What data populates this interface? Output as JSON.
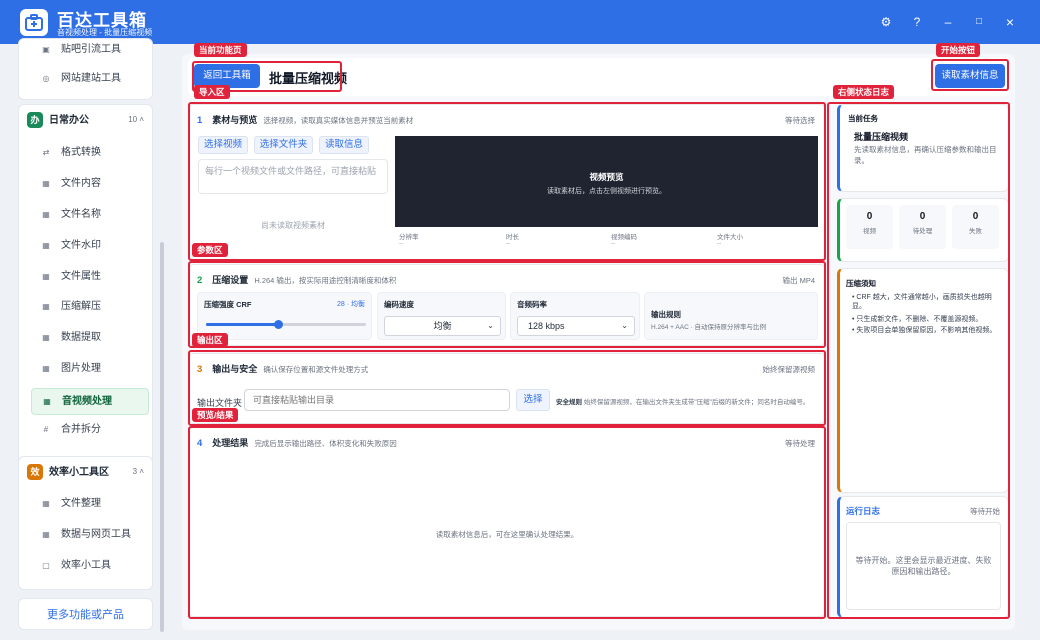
{
  "app": {
    "title": "百达工具箱",
    "subtitle": "音视频处理 - 批量压缩视频"
  },
  "window_controls": {
    "settings": "⚙",
    "help": "?",
    "minimize": "–",
    "maximize": "□",
    "close": "×"
  },
  "sidebar": {
    "top_items": [
      {
        "icon": "grid-icon",
        "label": "贴吧引流工具"
      },
      {
        "icon": "globe-icon",
        "label": "网站建站工具"
      }
    ],
    "group_office": {
      "badge": "办",
      "label": "日常办公",
      "count": "10 ˄",
      "color": "#1b8a5a"
    },
    "office_items": [
      {
        "icon": "swap-icon",
        "label": "格式转换"
      },
      {
        "icon": "grid-icon",
        "label": "文件内容"
      },
      {
        "icon": "grid-icon",
        "label": "文件名称"
      },
      {
        "icon": "grid-icon",
        "label": "文件水印"
      },
      {
        "icon": "grid-icon",
        "label": "文件属性"
      },
      {
        "icon": "grid-icon",
        "label": "压缩解压"
      },
      {
        "icon": "grid-icon",
        "label": "数据提取"
      },
      {
        "icon": "grid-icon",
        "label": "图片处理"
      },
      {
        "icon": "grid-icon",
        "label": "音视频处理"
      },
      {
        "icon": "hash-icon",
        "label": "合并拆分"
      }
    ],
    "group_efficiency": {
      "badge": "效",
      "label": "效率小工具区",
      "count": "3 ˄",
      "color": "#d97706"
    },
    "efficiency_items": [
      {
        "icon": "grid-icon",
        "label": "文件整理"
      },
      {
        "icon": "grid-icon",
        "label": "数据与网页工具"
      },
      {
        "icon": "box-icon",
        "label": "效率小工具"
      }
    ],
    "more_button": "更多功能或产品"
  },
  "annotations": {
    "current_page": "当前功能页",
    "start_button": "开始按钮",
    "import_area": "导入区",
    "right_status": "右侧状态日志",
    "params_area": "参数区",
    "output_area": "输出区",
    "preview_result": "预览/结果"
  },
  "topbar": {
    "back_button": "返回工具箱",
    "page_title": "批量压缩视频",
    "read_button": "读取素材信息"
  },
  "section1": {
    "num": "1",
    "title": "素材与预览",
    "desc": "选择视频，读取真实媒体信息并预览当前素材",
    "status": "等待选择",
    "btn_select_video": "选择视频",
    "btn_select_folder": "选择文件夹",
    "btn_read_info": "读取信息",
    "textarea_placeholder": "每行一个视频文件或文件路径，可直接粘贴",
    "empty_text": "尚未读取视频素材",
    "preview_title": "视频预览",
    "preview_hint": "读取素材后，点击左侧视频进行预览。",
    "meta": [
      {
        "label": "分辨率",
        "value": "--"
      },
      {
        "label": "时长",
        "value": "--"
      },
      {
        "label": "视频编码",
        "value": "--"
      },
      {
        "label": "文件大小",
        "value": "--"
      }
    ]
  },
  "section2": {
    "num": "2",
    "title": "压缩设置",
    "desc": "H.264 输出，按实际用途控制清晰度和体积",
    "status": "输出 MP4",
    "crf_label": "压缩强度 CRF",
    "crf_value": "28 · 均衡",
    "crf_level": 0.45,
    "speed_label": "编码速度",
    "speed_value": "均衡",
    "bitrate_label": "音频码率",
    "bitrate_value": "128 kbps",
    "rule_label": "输出规则",
    "rule_text": "H.264 + AAC · 自动保持原分辨率与比例"
  },
  "section3": {
    "num": "3",
    "title": "输出与安全",
    "desc": "确认保存位置和源文件处理方式",
    "status": "始终保留源视频",
    "folder_label": "输出文件夹",
    "folder_placeholder": "可直接粘贴输出目录",
    "choose_button": "选择",
    "rule_title": "安全规则",
    "rule_text": "始终保留源视频，在输出文件夹生成带\"压缩\"后缀的新文件；同名时自动编号。"
  },
  "section4": {
    "num": "4",
    "title": "处理结果",
    "desc": "完成后显示输出路径、体积变化和失败原因",
    "status": "等待处理",
    "empty_text": "读取素材信息后，可在这里确认处理结果。"
  },
  "right_panel": {
    "task_label": "当前任务",
    "task_title": "批量压缩视频",
    "task_desc": "先读取素材信息，再确认压缩参数和输出目录。",
    "stats": [
      {
        "value": "0",
        "label": "视频"
      },
      {
        "value": "0",
        "label": "待处理"
      },
      {
        "value": "0",
        "label": "失败"
      }
    ],
    "notes_title": "压缩须知",
    "notes": [
      "CRF 越大，文件通常越小，画质损失也越明显。",
      "只生成新文件，不删除、不覆盖源视频。",
      "失败项目会单独保留原因，不影响其他视频。"
    ],
    "log_title": "运行日志",
    "log_status": "等待开始",
    "log_text": "等待开始。这里会显示最近进度、失败原因和输出路径。"
  },
  "colors": {
    "primary": "#2f6fe6",
    "annotation": "#e0233a",
    "active_green": "#10643b"
  }
}
